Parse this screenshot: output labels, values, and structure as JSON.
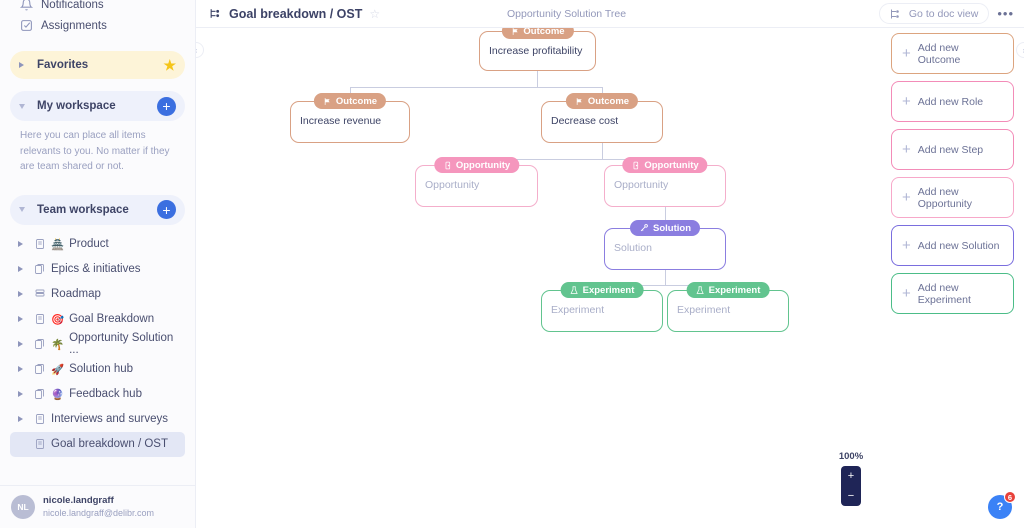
{
  "sidebar": {
    "top_items": [
      {
        "label": "Notifications",
        "icon": "bell-icon"
      },
      {
        "label": "Assignments",
        "icon": "checkbox-icon"
      }
    ],
    "favorites": {
      "label": "Favorites",
      "icon": "star-icon"
    },
    "my_workspace": {
      "label": "My workspace",
      "add_label": "+",
      "description": "Here you can place all items relevants to you. No matter if they are team shared or not."
    },
    "team_workspace": {
      "label": "Team workspace",
      "add_label": "+"
    },
    "tree": [
      {
        "label": "Product",
        "emoji": "🏯",
        "doc": "page-icon",
        "expandable": true,
        "selected": false
      },
      {
        "label": "Epics & initiatives",
        "emoji": "",
        "doc": "pages-icon",
        "expandable": true,
        "selected": false
      },
      {
        "label": "Roadmap",
        "emoji": "",
        "doc": "board-icon",
        "expandable": true,
        "selected": false
      },
      {
        "label": "Goal Breakdown",
        "emoji": "🎯",
        "doc": "page-icon",
        "expandable": true,
        "selected": false
      },
      {
        "label": "Opportunity Solution ...",
        "emoji": "🌴",
        "doc": "pages-icon",
        "expandable": true,
        "selected": false
      },
      {
        "label": "Solution hub",
        "emoji": "🚀",
        "doc": "pages-icon",
        "expandable": true,
        "selected": false
      },
      {
        "label": "Feedback hub",
        "emoji": "🔮",
        "doc": "pages-icon",
        "expandable": true,
        "selected": false
      },
      {
        "label": "Interviews and surveys",
        "emoji": "",
        "doc": "page-icon",
        "expandable": true,
        "selected": false
      },
      {
        "label": "Goal breakdown / OST",
        "emoji": "",
        "doc": "page-icon",
        "expandable": false,
        "selected": true
      }
    ],
    "user": {
      "initials": "NL",
      "name": "nicole.landgraff",
      "email": "nicole.landgraff@delibr.com"
    }
  },
  "topbar": {
    "title": "Goal breakdown / OST",
    "star": "☆",
    "center_label": "Opportunity Solution Tree",
    "doc_view_label": "Go to doc view",
    "more_label": "•••"
  },
  "canvas": {
    "nodes": [
      {
        "id": "n1",
        "chip": "Outcome",
        "chip_icon": "flag-icon",
        "text": "Increase profitability",
        "placeholder": false,
        "color": "#d9a184",
        "chip_color": "#d9a184"
      },
      {
        "id": "n2",
        "chip": "Outcome",
        "chip_icon": "flag-icon",
        "text": "Increase revenue",
        "placeholder": false,
        "color": "#d9a184",
        "chip_color": "#d9a184"
      },
      {
        "id": "n3",
        "chip": "Outcome",
        "chip_icon": "flag-icon",
        "text": "Decrease cost",
        "placeholder": false,
        "color": "#d9a184",
        "chip_color": "#d9a184"
      },
      {
        "id": "n4",
        "chip": "Opportunity",
        "chip_icon": "door-icon",
        "text": "Opportunity",
        "placeholder": true,
        "color": "#f4aecb",
        "chip_color": "#f596bd"
      },
      {
        "id": "n5",
        "chip": "Opportunity",
        "chip_icon": "door-icon",
        "text": "Opportunity",
        "placeholder": true,
        "color": "#f4aecb",
        "chip_color": "#f596bd"
      },
      {
        "id": "n6",
        "chip": "Solution",
        "chip_icon": "key-icon",
        "text": "Solution",
        "placeholder": true,
        "color": "#8b7ee0",
        "chip_color": "#8b7ee0"
      },
      {
        "id": "n7",
        "chip": "Experiment",
        "chip_icon": "flask-icon",
        "text": "Experiment",
        "placeholder": true,
        "color": "#62c48f",
        "chip_color": "#62c48f"
      },
      {
        "id": "n8",
        "chip": "Experiment",
        "chip_icon": "flask-icon",
        "text": "Experiment",
        "placeholder": true,
        "color": "#62c48f",
        "chip_color": "#62c48f"
      }
    ],
    "zoom": {
      "percent": "100%",
      "zoom_in": "+",
      "zoom_out": "−"
    },
    "collapse_left": "‹",
    "collapse_right": "›"
  },
  "rail": {
    "buttons": [
      {
        "label": "Add new Outcome",
        "color": "#dca47f"
      },
      {
        "label": "Add new Role",
        "color": "#f38cb8"
      },
      {
        "label": "Add new Step",
        "color": "#f38cb8"
      },
      {
        "label": "Add new Opportunity",
        "color": "#f7a8c9"
      },
      {
        "label": "Add new Solution",
        "color": "#7a6ede"
      },
      {
        "label": "Add new Experiment",
        "color": "#4cbd88"
      }
    ],
    "plus": "+"
  },
  "help": {
    "label": "?",
    "badge": "6"
  }
}
